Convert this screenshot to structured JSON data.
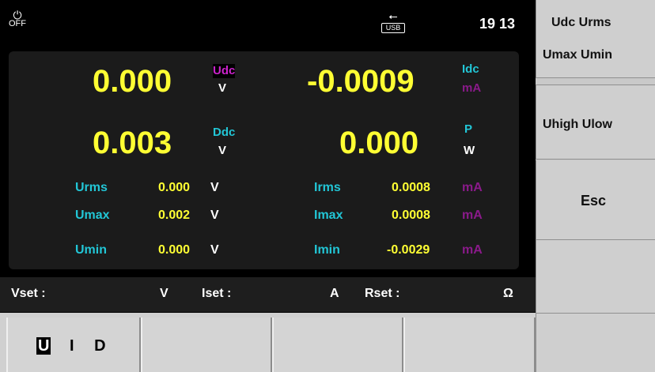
{
  "topbar": {
    "power_label": "OFF",
    "usb_label": "USB",
    "clock": "19 13"
  },
  "main": {
    "u_value": "0.000",
    "u_name": "Udc",
    "u_unit": "V",
    "d_value": "0.003",
    "d_name": "Ddc",
    "d_unit": "V",
    "i_value": "-0.0009",
    "i_name": "Idc",
    "i_unit": "mA",
    "p_value": "0.000",
    "p_name": "P",
    "p_unit": "W",
    "rows": [
      {
        "vname": "Urms",
        "vval": "0.000",
        "vunit": "V",
        "iname": "Irms",
        "ival": "0.0008",
        "iunit": "mA"
      },
      {
        "vname": "Umax",
        "vval": "0.002",
        "vunit": "V",
        "iname": "Imax",
        "ival": "0.0008",
        "iunit": "mA"
      },
      {
        "vname": "Umin",
        "vval": "0.000",
        "vunit": "V",
        "iname": "Imin",
        "ival": "-0.0029",
        "iunit": "mA"
      }
    ]
  },
  "status": {
    "vset": "Vset :",
    "vset_unit": "V",
    "iset": "Iset :",
    "iset_unit": "A",
    "rset": "Rset :",
    "rset_unit": "Ω"
  },
  "softkeys": {
    "k1_line1": "Udc  Urms",
    "k1_line2": "Umax Umin",
    "k2": "Uhigh Ulow",
    "k3": "Esc"
  },
  "bottom": {
    "m_u": "U",
    "m_i": "I",
    "m_d": "D"
  },
  "colors": {
    "yellow": "#ffff33",
    "cyan": "#22c6d6",
    "magenta": "#cc22cc",
    "purple": "#8a1a8a",
    "white": "#ffffff"
  }
}
